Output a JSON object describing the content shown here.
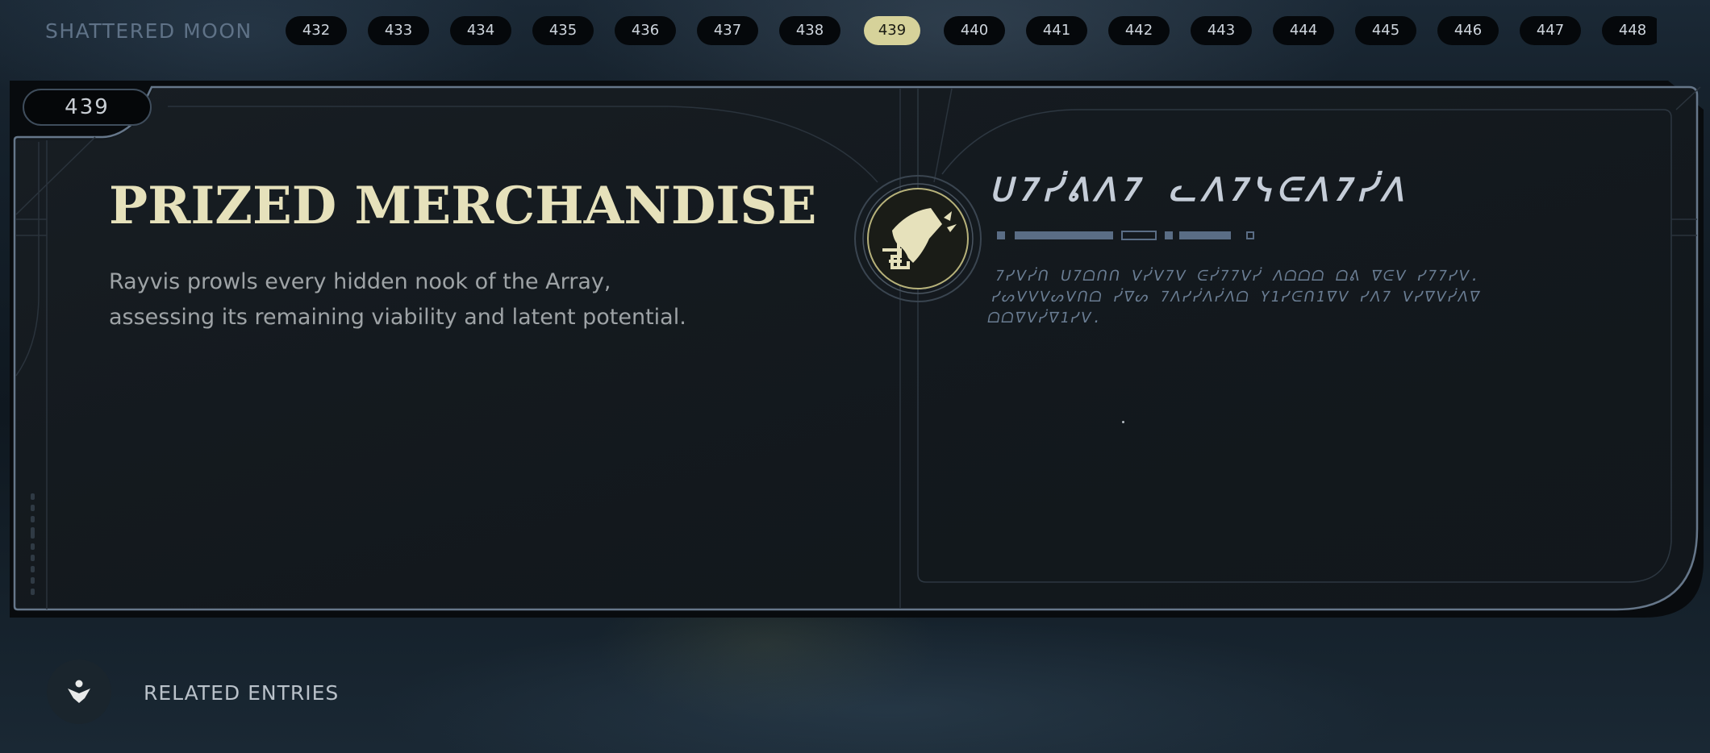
{
  "header": {
    "game_title": "SHATTERED MOON",
    "entries": [
      {
        "label": "432",
        "active": false
      },
      {
        "label": "433",
        "active": false
      },
      {
        "label": "434",
        "active": false
      },
      {
        "label": "435",
        "active": false
      },
      {
        "label": "436",
        "active": false
      },
      {
        "label": "437",
        "active": false
      },
      {
        "label": "438",
        "active": false
      },
      {
        "label": "439",
        "active": true
      },
      {
        "label": "440",
        "active": false
      },
      {
        "label": "441",
        "active": false
      },
      {
        "label": "442",
        "active": false
      },
      {
        "label": "443",
        "active": false
      },
      {
        "label": "444",
        "active": false
      },
      {
        "label": "445",
        "active": false
      },
      {
        "label": "446",
        "active": false
      },
      {
        "label": "447",
        "active": false
      },
      {
        "label": "448",
        "active": false
      }
    ]
  },
  "entry": {
    "number": "439",
    "title": "PRIZED MERCHANDISE",
    "description": "Rayvis prowls every hidden nook of the Array, assessing its remaining viability and latent potential.",
    "emblem_icon": "merchandise-emblem-icon",
    "alien_title": "ᑌ7ᓰᕕᐱ7 ᓚᐱ7ᓭᕮᐱ7ᓰᐱ",
    "alien_text": "7ᓯᐯᓰᑎ ᑌ7ᗝᑎᑎ ᐯᓰᐯ7ᐯ ᕮᓰ77ᐯᓰ ᐱᗝᗝᗝ ᗝᕕ ᐁᕮᐯ ᓯ77ᓯᐯ. ᓯᔕᐯᐯᐯᔕᐯᑎᗝ ᓰᐁᔕ 7ᐱᓯᓰᐱᓰᐱᗝ Y1ᓯᕮᑎ1ᐁᐯ ᓯᐱ7 ᐯᓯᐁᐯᓰᐱᐁ ᗝᗝᐁᐯᓰᐁ1ᓯᐯ."
  },
  "footer": {
    "related_label": "RELATED ENTRIES",
    "related_icon": "related-entries-icon"
  },
  "colors": {
    "accent": "#d6d29a",
    "title": "#e6e1bb",
    "panel_border": "#6b7b8c",
    "panel_fill": "#131a1f"
  }
}
